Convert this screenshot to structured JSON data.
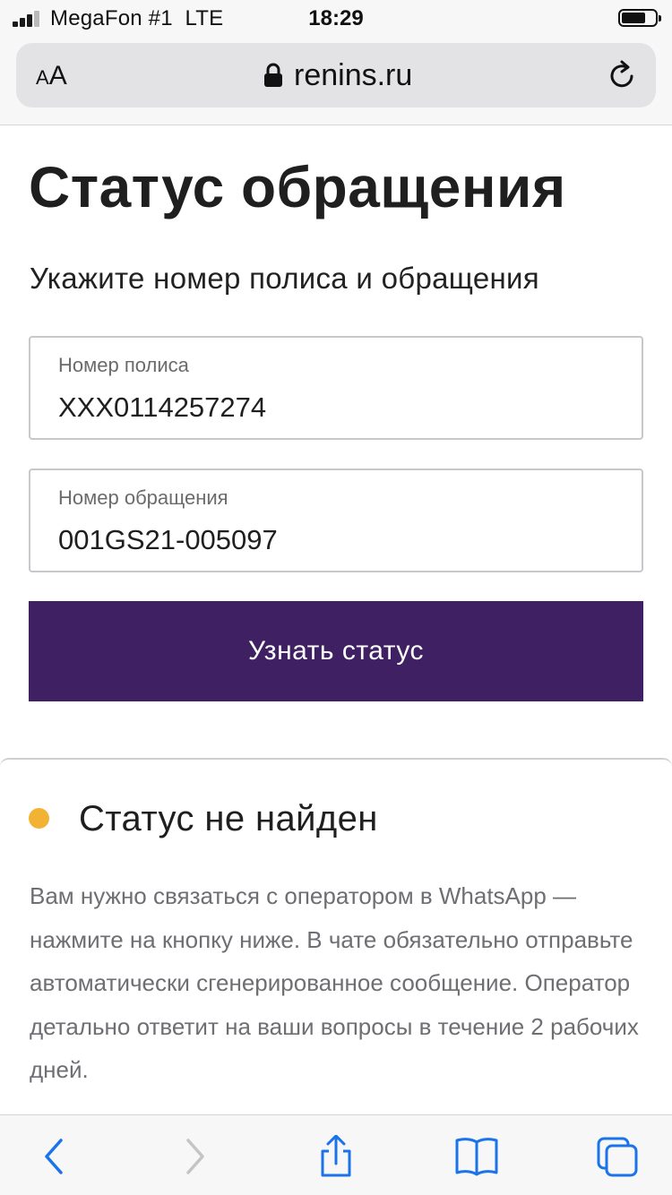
{
  "status_bar": {
    "carrier": "MegaFon #1",
    "network": "LTE",
    "time": "18:29"
  },
  "browser": {
    "text_size_label": "AA",
    "url": "renins.ru"
  },
  "page": {
    "title": "Статус обращения",
    "subtitle": "Укажите номер полиса и обращения",
    "policy_field": {
      "label": "Номер полиса",
      "value": "XXX0114257274"
    },
    "request_field": {
      "label": "Номер обращения",
      "value": "001GS21-005097"
    },
    "submit_label": "Узнать статус"
  },
  "result": {
    "status_color": "#f2b233",
    "title": "Статус не найден",
    "message": "Вам нужно связаться с оператором в WhatsApp — нажмите на кнопку ниже. В чате обязательно отправьте автоматически сгенерированное сообщение. Оператор детально ответит на ваши вопросы в течение 2 рабочих дней."
  },
  "toolbar": {
    "icons": [
      "back-icon",
      "forward-icon",
      "share-icon",
      "bookmarks-icon",
      "tabs-icon"
    ],
    "accent_color": "#1a73e8"
  }
}
